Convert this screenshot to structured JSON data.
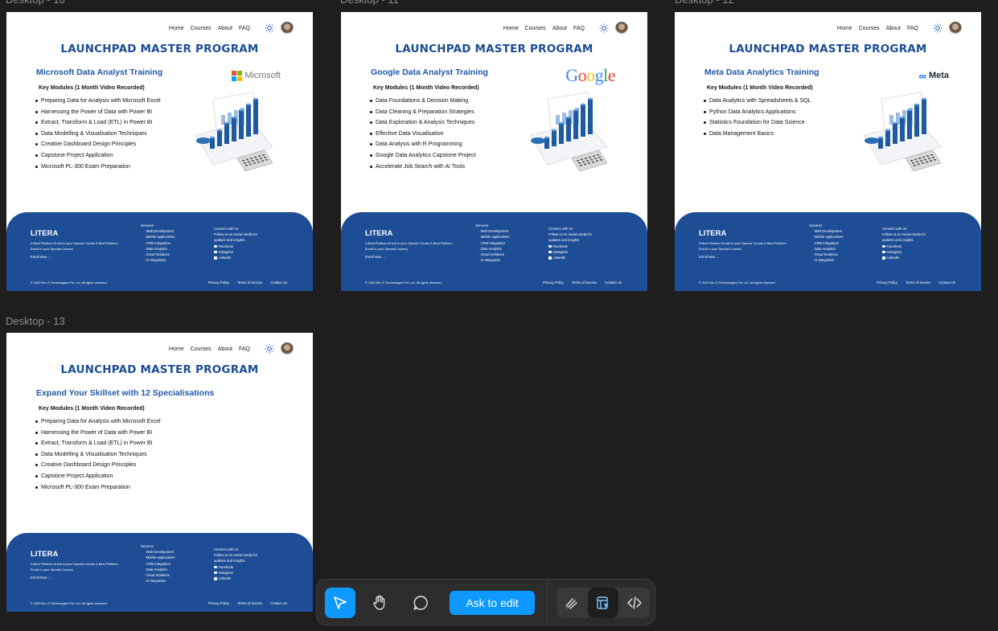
{
  "frames": [
    {
      "label": "Desktop - 10",
      "subtitle": "Microsoft Data Analyst Training",
      "brand": "Microsoft",
      "modules": [
        "Preparing Data for Analysis with Microsoft Excel",
        "Harnessing the Power of Data with Power BI",
        "Extract, Transform & Load (ETL) in Power BI",
        "Data Modelling & Visualisation Techniques",
        "Creative Dashboard Design Principles",
        "Capstone Project Application",
        "Microsoft PL-300 Exam Preparation"
      ]
    },
    {
      "label": "Desktop - 11",
      "subtitle": "Google Data Analyst Training",
      "brand": "Google",
      "modules": [
        "Data Foundations & Decision Making",
        "Data Cleaning & Preparation Strategies",
        "Data Exploration & Analysis Techniques",
        "Effective Data Visualisation",
        "Data Analysis with R Programming",
        "Google Data Analytics Capstone Project",
        "Accelerate Job Search with AI Tools"
      ]
    },
    {
      "label": "Desktop - 12",
      "subtitle": "Meta Data Analytics Training",
      "brand": "Meta",
      "modules": [
        "Data Analytics with Spreadsheets & SQL",
        "Python Data Analytics Applications",
        "Statistics Foundation for Data Science",
        "Data Management Basics"
      ]
    },
    {
      "label": "Desktop - 13",
      "subtitle": "Expand Your Skillset with 12  Specialisations",
      "brand": "",
      "modules": [
        "Preparing Data for Analysis with Microsoft Excel",
        "Harnessing the Power of Data with Power BI",
        "Extract, Transform & Load (ETL) in Power BI",
        "Data Modelling & Visualisation Techniques",
        "Creative Dashboard Design Principles",
        "Capstone Project Application",
        "Microsoft PL-300 Exam Preparation"
      ]
    }
  ],
  "nav": {
    "items": [
      "Home",
      "Courses",
      "About",
      "FAQ"
    ]
  },
  "title": "LAUNCHPAD MASTER PROGRAM",
  "modules_heading": "Key Modules (1 Month Video Recorded)",
  "footer": {
    "logo": "LITERA",
    "tagline": "A Best Platform Enroll in your Special Course A Best Platform Enroll in your Special Course]",
    "enroll": "Enroll Now →",
    "services_title": "Services",
    "services": [
      "Web Development",
      "Mobile Applications",
      "CRM Integration",
      "Data Analytics",
      "Cloud Solutions",
      "AI Integration"
    ],
    "connect_title": "Connect with Us",
    "connect_text": "Follow us on social media for updates and insights",
    "socials": [
      "Facebook",
      "Instagram",
      "LinkedIn"
    ],
    "copyright": "© 2025 Kin-G Technologies Pvt. Ltd. All rights reserved.",
    "links": [
      "Privacy Policy",
      "Terms of Service",
      "Contact Us"
    ]
  },
  "toolbar": {
    "ask_label": "Ask to edit"
  },
  "colors": {
    "brand_blue": "#1c4d95",
    "accent": "#0d99ff",
    "canvas": "#1e1e1e"
  }
}
